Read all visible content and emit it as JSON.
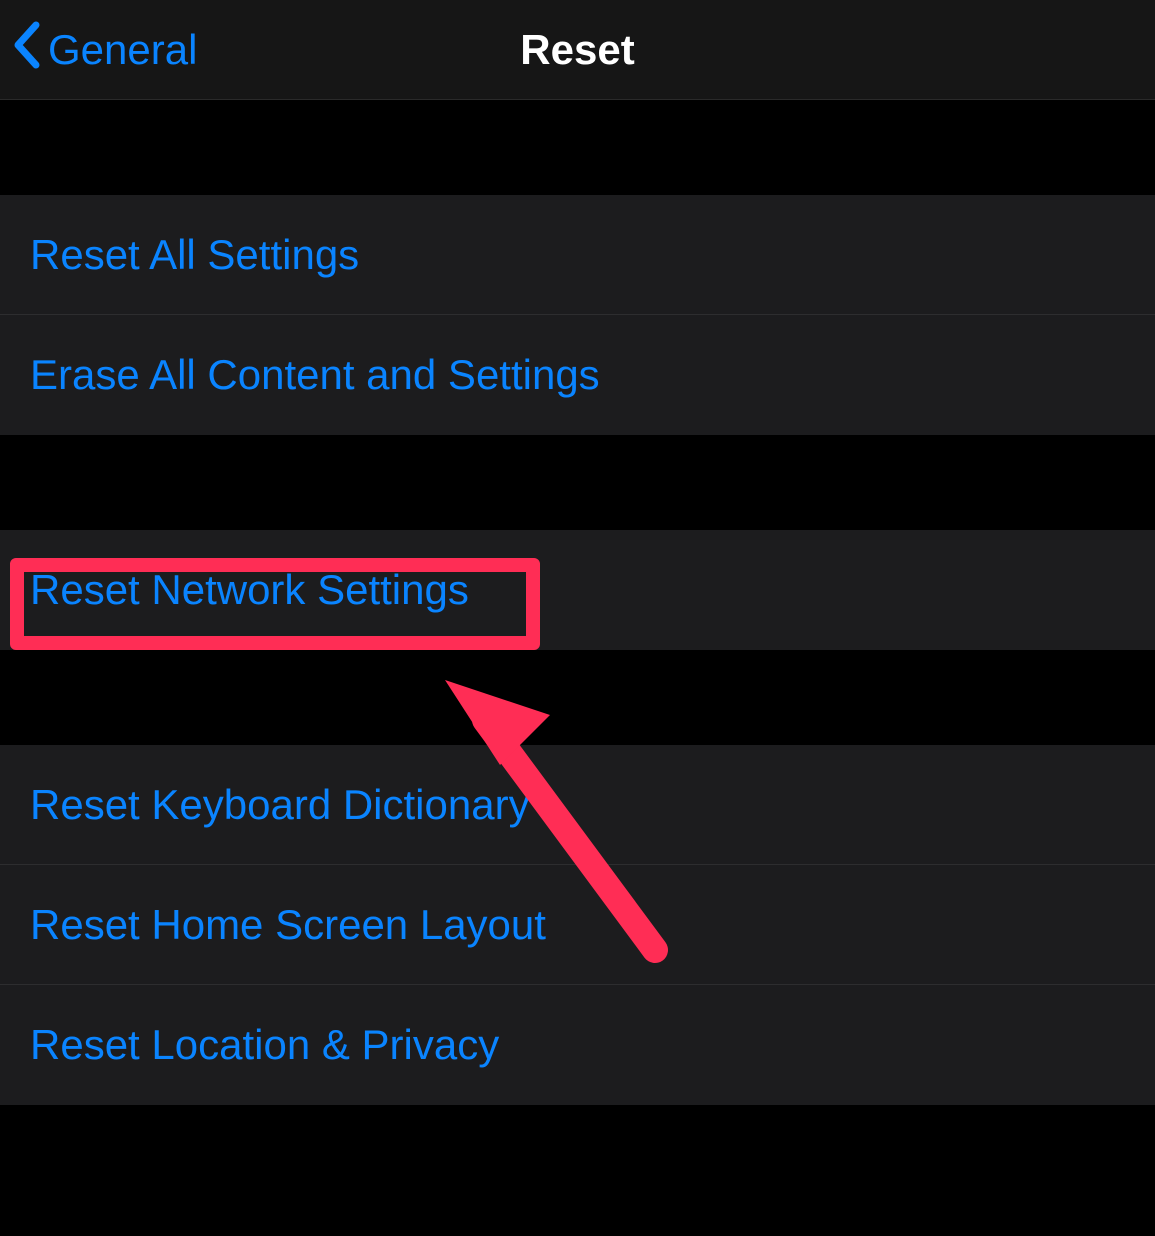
{
  "nav": {
    "back_label": "General",
    "title": "Reset"
  },
  "group1": {
    "items": [
      {
        "label": "Reset All Settings"
      },
      {
        "label": "Erase All Content and Settings"
      }
    ]
  },
  "group2": {
    "items": [
      {
        "label": "Reset Network Settings"
      }
    ]
  },
  "group3": {
    "items": [
      {
        "label": "Reset Keyboard Dictionary"
      },
      {
        "label": "Reset Home Screen Layout"
      },
      {
        "label": "Reset Location & Privacy"
      }
    ]
  },
  "annotation": {
    "highlight_color": "#ff2d55",
    "arrow_color": "#ff2d55"
  }
}
